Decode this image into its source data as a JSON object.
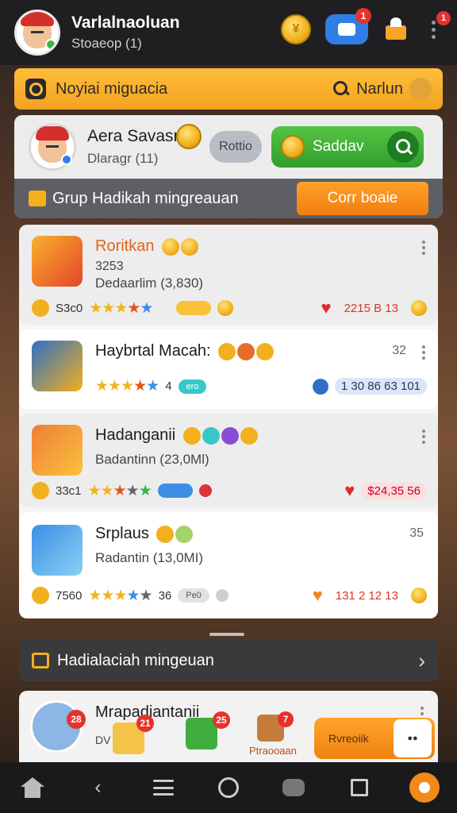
{
  "top": {
    "user_name": "Varlalnaoluan",
    "user_sub": "Stoaeop (1)",
    "chat_badge": "1",
    "menu_badge": "1"
  },
  "search": {
    "placeholder": "Noyiai miguacia",
    "right_label": "Narlun"
  },
  "profile": {
    "name": "Aera Savasra",
    "sub": "Dlaragr (11)",
    "gray_pill": "Rottio",
    "green_pill": "Saddav",
    "group_text": "Grup Hadikah mingreauan",
    "orange_button": "Corr boaie"
  },
  "items": [
    {
      "title": "Roritkan",
      "line2": "3253",
      "line3": "Dedaarlim (3,830)",
      "left_num": "S3c0",
      "value": "2215 B 13"
    },
    {
      "title": "Haybrtal Macah:",
      "right_num": "32",
      "stars_num": "4",
      "pill": "ero",
      "value": "1 30 86 63 101"
    },
    {
      "title": "Hadanganii",
      "line2": "Badantinn (23,0Ml)",
      "left_num": "33c1",
      "pill": "",
      "value": "$24,35 56"
    },
    {
      "title": "Srplaus",
      "right_num": "35",
      "line2": "Radantin (13,0MI)",
      "left_num": "7560",
      "stars_num": "36",
      "pill": "Pe0",
      "value": "131 2 12 13"
    }
  ],
  "weekly": {
    "label": "Hadialaciah mingeuan"
  },
  "promo": {
    "title": "Mrapadiantanii",
    "sub": "DV",
    "badge1": "28",
    "badge2": "21",
    "badge3": "25",
    "badge4": "7",
    "label": "Ptraooaan",
    "button": "Rvreoiik"
  }
}
